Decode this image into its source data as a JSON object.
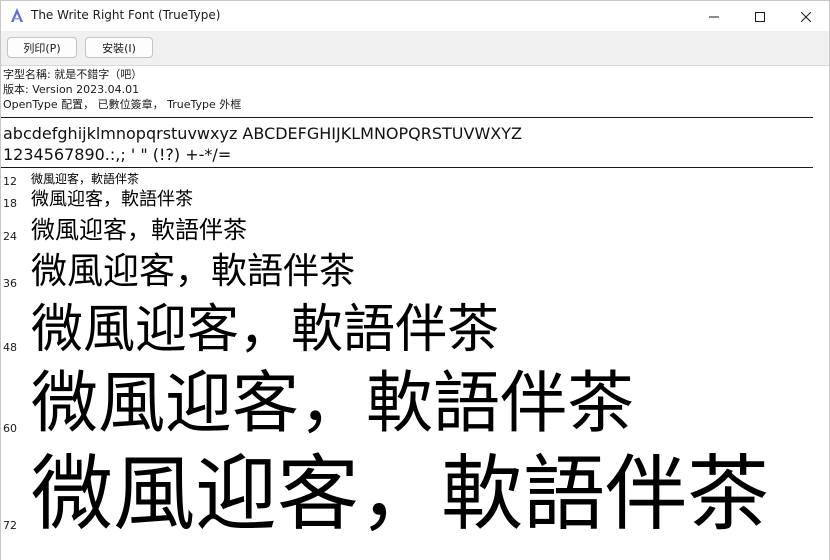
{
  "window": {
    "title": "The Write Right Font (TrueType)"
  },
  "toolbar": {
    "print_label": "列印(P)",
    "install_label": "安裝(I)"
  },
  "info": {
    "name_line": "字型名稱: 就是不錯字（吧）",
    "version_line": "版本: Version 2023.04.01",
    "type_line": "OpenType 配置， 已數位簽章， TrueType 外框"
  },
  "charset": {
    "line1": "abcdefghijklmnopqrstuvwxyz ABCDEFGHIJKLMNOPQRSTUVWXYZ",
    "line2": "1234567890.:,; ' \" (!?) +-*/="
  },
  "samples": [
    {
      "size": "12",
      "text": "微風迎客，軟語伴茶"
    },
    {
      "size": "18",
      "text": "微風迎客，軟語伴茶"
    },
    {
      "size": "24",
      "text": "微風迎客，軟語伴茶"
    },
    {
      "size": "36",
      "text": "微風迎客，軟語伴茶"
    },
    {
      "size": "48",
      "text": "微風迎客，軟語伴茶"
    },
    {
      "size": "60",
      "text": "微風迎客，軟語伴茶"
    },
    {
      "size": "72",
      "text": "微風迎客，軟語伴茶"
    }
  ],
  "icons": {
    "app": "font-app-icon",
    "minimize": "minimize-icon",
    "maximize": "maximize-icon",
    "close": "close-icon"
  },
  "colors": {
    "app_icon": "#5b6fd6",
    "text": "#000000",
    "toolbar_bg": "#f0f0f0"
  }
}
